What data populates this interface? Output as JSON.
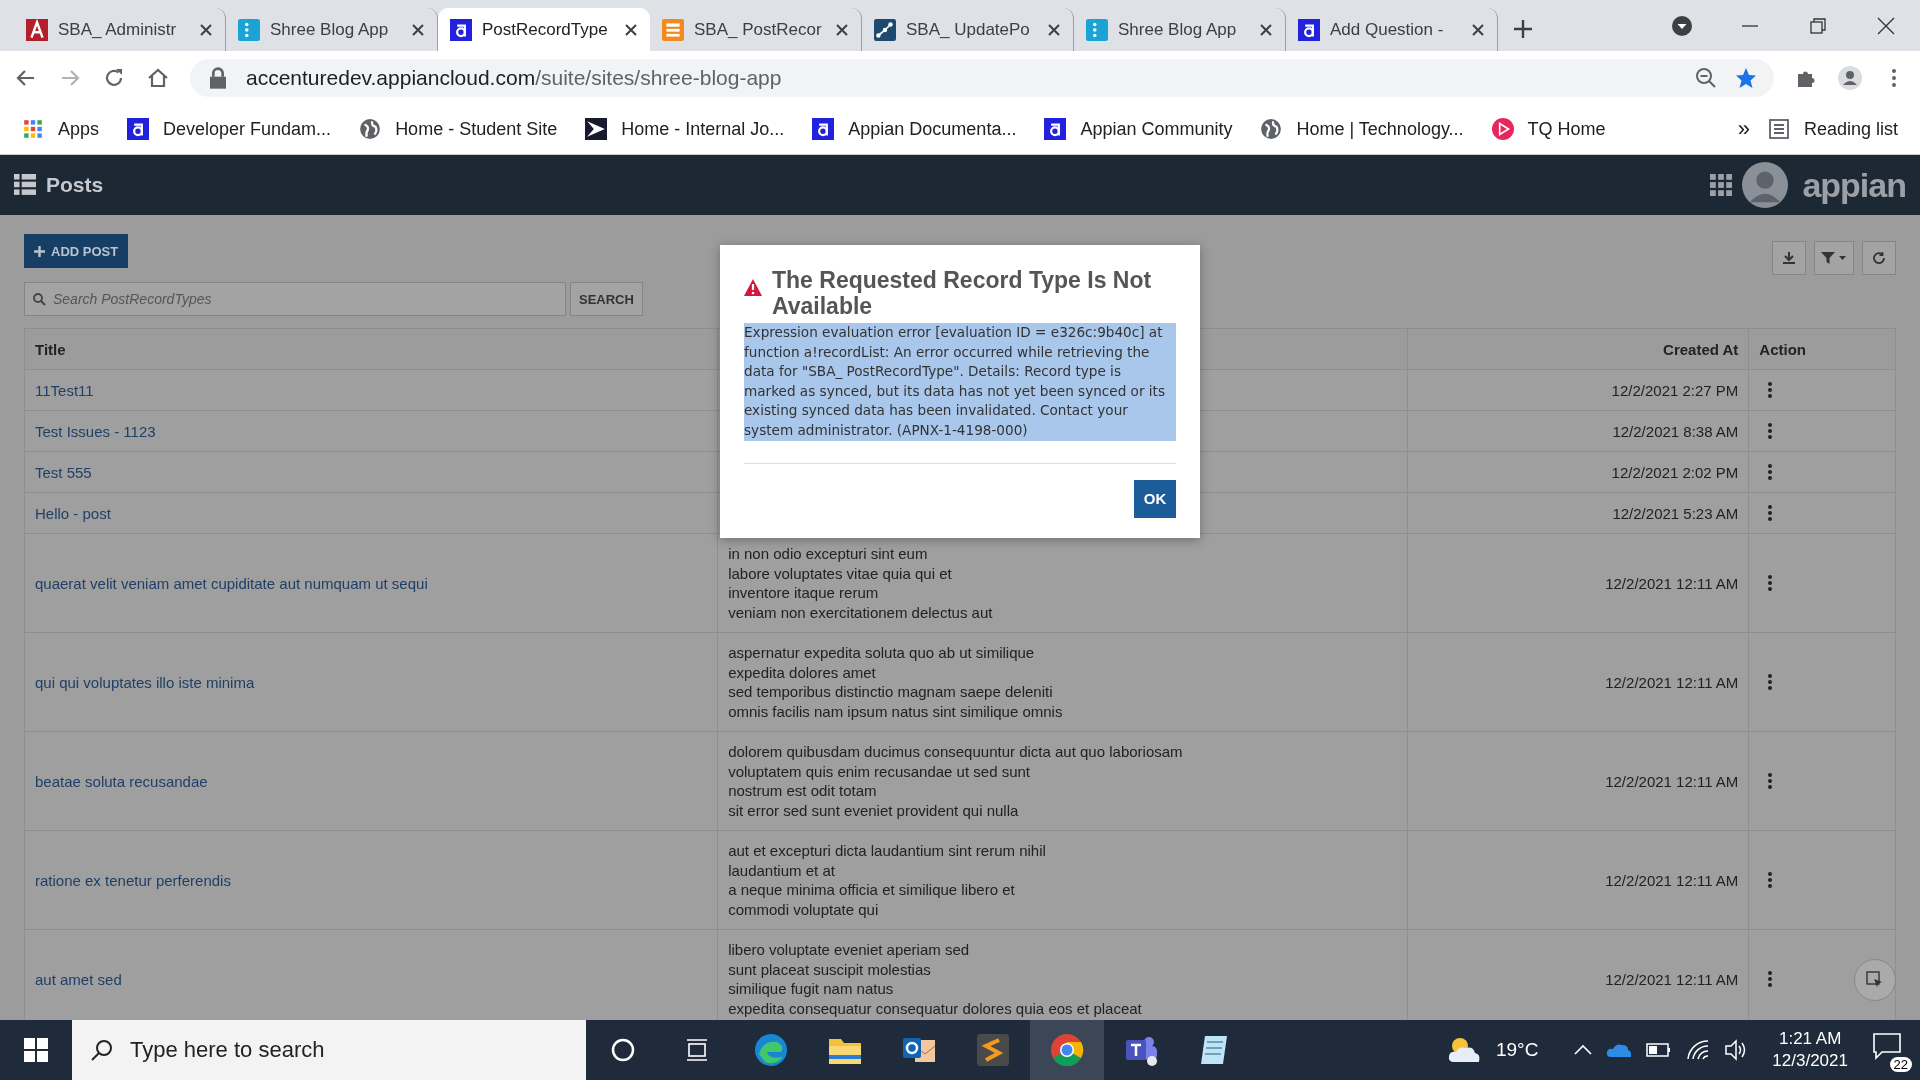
{
  "browser": {
    "tabs": [
      {
        "kind": "appian-red",
        "title": "SBA_ Administr",
        "selected": false
      },
      {
        "kind": "blog",
        "title": "Shree Blog App",
        "selected": false
      },
      {
        "kind": "appian",
        "title": "PostRecordType",
        "selected": true
      },
      {
        "kind": "record",
        "title": "SBA_ PostRecor",
        "selected": false
      },
      {
        "kind": "process",
        "title": "SBA_ UpdatePo",
        "selected": false
      },
      {
        "kind": "blog",
        "title": "Shree Blog App",
        "selected": false
      },
      {
        "kind": "appian",
        "title": "Add Question -",
        "selected": false
      }
    ],
    "url_host": "accenturedev.appiancloud.com",
    "url_path": "/suite/sites/shree-blog-app",
    "bookmarks": [
      {
        "kind": "apps",
        "label": "Apps"
      },
      {
        "kind": "appian",
        "label": "Developer Fundam..."
      },
      {
        "kind": "globe",
        "label": "Home - Student Site"
      },
      {
        "kind": "flag",
        "label": "Home - Internal Jo..."
      },
      {
        "kind": "appian",
        "label": "Appian Documenta..."
      },
      {
        "kind": "appian",
        "label": "Appian Community"
      },
      {
        "kind": "globe",
        "label": "Home | Technology..."
      },
      {
        "kind": "play",
        "label": "TQ Home"
      }
    ],
    "more": "»",
    "reading_list": "Reading list"
  },
  "app": {
    "title": "Posts",
    "logo": "appian",
    "add_button": "ADD POST",
    "search": {
      "placeholder": "Search PostRecordTypes"
    },
    "search_button": "SEARCH",
    "table": {
      "columns": [
        "Title",
        "Created At",
        "Action"
      ],
      "rows": [
        {
          "title": "11Test11",
          "body": [],
          "created": "12/2/2021 2:27 PM"
        },
        {
          "title": "Test Issues - 1123",
          "body": [],
          "created": "12/2/2021 8:38 AM"
        },
        {
          "title": "Test 555",
          "body": [],
          "created": "12/2/2021 2:02 PM"
        },
        {
          "title": "Hello - post",
          "body": [],
          "created": "12/2/2021 5:23 AM"
        },
        {
          "title": "quaerat velit veniam amet cupiditate aut numquam ut sequi",
          "body": [
            "in non odio excepturi sint eum",
            "labore voluptates vitae quia qui et",
            "inventore itaque rerum",
            "veniam non exercitationem delectus aut"
          ],
          "created": "12/2/2021 12:11 AM"
        },
        {
          "title": "qui qui voluptates illo iste minima",
          "body": [
            "aspernatur expedita soluta quo ab ut similique",
            "expedita dolores amet",
            "sed temporibus distinctio magnam saepe deleniti",
            "omnis facilis nam ipsum natus sint similique omnis"
          ],
          "created": "12/2/2021 12:11 AM"
        },
        {
          "title": "beatae soluta recusandae",
          "body": [
            "dolorem quibusdam ducimus consequuntur dicta aut quo laboriosam",
            "voluptatem quis enim recusandae ut sed sunt",
            "nostrum est odit totam",
            "sit error sed sunt eveniet provident qui nulla"
          ],
          "created": "12/2/2021 12:11 AM"
        },
        {
          "title": "ratione ex tenetur perferendis",
          "body": [
            "aut et excepturi dicta laudantium sint rerum nihil",
            "laudantium et at",
            "a neque minima officia et similique libero et",
            "commodi voluptate qui"
          ],
          "created": "12/2/2021 12:11 AM"
        },
        {
          "title": "aut amet sed",
          "body": [
            "libero voluptate eveniet aperiam sed",
            "sunt placeat suscipit molestias",
            "similique fugit nam natus",
            "expedita consequatur consequatur dolores quia eos et placeat"
          ],
          "created": "12/2/2021 12:11 AM"
        }
      ]
    }
  },
  "dialog": {
    "title": "The Requested Record Type Is Not Available",
    "message": "Expression evaluation error [evaluation ID = e326c:9b40c] at function a!recordList: An error occurred while retrieving the data for \"SBA_ PostRecordType\". Details: Record type is marked as synced, but its data has not yet been synced or its existing synced data has been invalidated. Contact your system administrator. (APNX-1-4198-000)",
    "message_selected": true,
    "ok": "OK"
  },
  "taskbar": {
    "search": {
      "placeholder": "Type here to search"
    },
    "temperature": "19°C",
    "time": "1:21 AM",
    "date": "12/3/2021",
    "notifications": "22"
  }
}
